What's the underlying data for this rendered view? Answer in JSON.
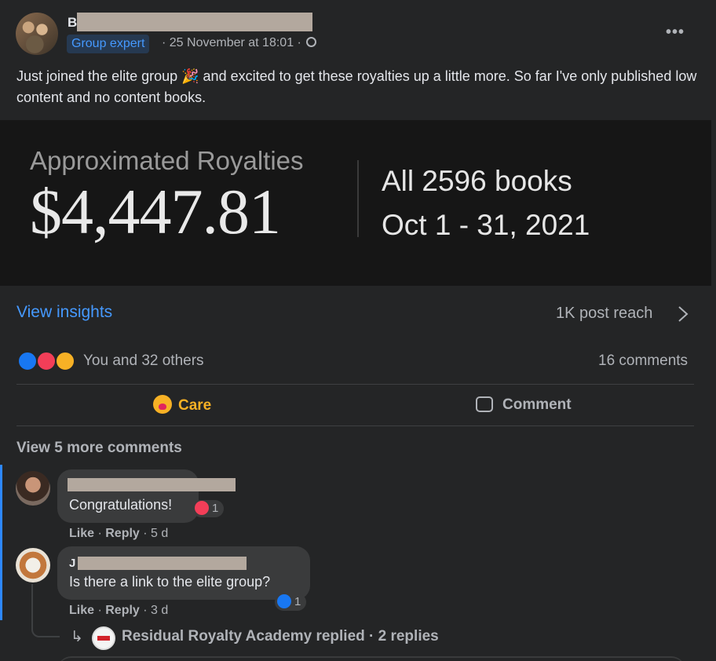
{
  "post": {
    "author_initial": "B",
    "badge": "Group expert",
    "meta_text": "· 25 November at 18:01 ·",
    "more_icon": "more-options-icon",
    "privacy_icon": "globe-icon",
    "text": "Just joined the elite group 🎉 and excited to get these royalties up a little more. So far I've only published low content and no content books."
  },
  "royalties_image": {
    "title": "Approximated Royalties",
    "amount": "$4,447.81",
    "books": "All 2596 books",
    "dates": "Oct 1 - 31, 2021"
  },
  "insights": {
    "link": "View insights",
    "reach": "1K post reach"
  },
  "reactions": {
    "icons": [
      "like-reaction-icon",
      "love-reaction-icon",
      "care-reaction-icon"
    ],
    "summary": "You and 32 others",
    "comments": "16 comments"
  },
  "actions": {
    "care": "Care",
    "comment": "Comment"
  },
  "comments_section": {
    "view_more": "View 5 more comments",
    "comments": [
      {
        "author_initial": "",
        "text": "Congratulations!",
        "reaction_count": "1",
        "like": "Like",
        "reply": "Reply",
        "age": "5 d"
      },
      {
        "author_initial": "J",
        "text": "Is there a link to the elite group?",
        "reaction_count": "1",
        "like": "Like",
        "reply": "Reply",
        "age": "3 d"
      }
    ],
    "reply_summary": "Residual Royalty Academy replied · 2 replies"
  },
  "colors": {
    "background": "#242526",
    "accent": "#4599ff",
    "care": "#f7b125",
    "text": "#e4e6eb",
    "muted": "#b0b3b8"
  }
}
